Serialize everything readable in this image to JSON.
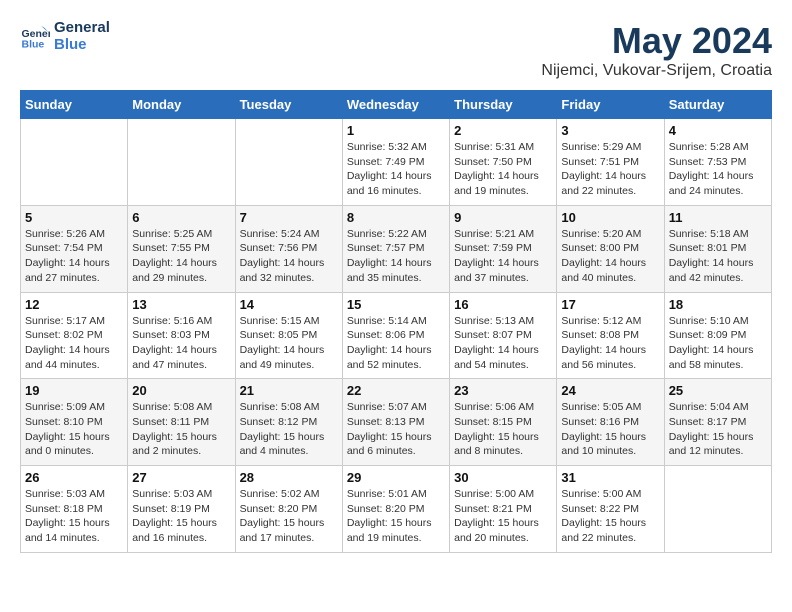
{
  "logo": {
    "line1": "General",
    "line2": "Blue"
  },
  "title": "May 2024",
  "location": "Nijemci, Vukovar-Srijem, Croatia",
  "days_header": [
    "Sunday",
    "Monday",
    "Tuesday",
    "Wednesday",
    "Thursday",
    "Friday",
    "Saturday"
  ],
  "weeks": [
    [
      {
        "day": "",
        "info": ""
      },
      {
        "day": "",
        "info": ""
      },
      {
        "day": "",
        "info": ""
      },
      {
        "day": "1",
        "info": "Sunrise: 5:32 AM\nSunset: 7:49 PM\nDaylight: 14 hours\nand 16 minutes."
      },
      {
        "day": "2",
        "info": "Sunrise: 5:31 AM\nSunset: 7:50 PM\nDaylight: 14 hours\nand 19 minutes."
      },
      {
        "day": "3",
        "info": "Sunrise: 5:29 AM\nSunset: 7:51 PM\nDaylight: 14 hours\nand 22 minutes."
      },
      {
        "day": "4",
        "info": "Sunrise: 5:28 AM\nSunset: 7:53 PM\nDaylight: 14 hours\nand 24 minutes."
      }
    ],
    [
      {
        "day": "5",
        "info": "Sunrise: 5:26 AM\nSunset: 7:54 PM\nDaylight: 14 hours\nand 27 minutes."
      },
      {
        "day": "6",
        "info": "Sunrise: 5:25 AM\nSunset: 7:55 PM\nDaylight: 14 hours\nand 29 minutes."
      },
      {
        "day": "7",
        "info": "Sunrise: 5:24 AM\nSunset: 7:56 PM\nDaylight: 14 hours\nand 32 minutes."
      },
      {
        "day": "8",
        "info": "Sunrise: 5:22 AM\nSunset: 7:57 PM\nDaylight: 14 hours\nand 35 minutes."
      },
      {
        "day": "9",
        "info": "Sunrise: 5:21 AM\nSunset: 7:59 PM\nDaylight: 14 hours\nand 37 minutes."
      },
      {
        "day": "10",
        "info": "Sunrise: 5:20 AM\nSunset: 8:00 PM\nDaylight: 14 hours\nand 40 minutes."
      },
      {
        "day": "11",
        "info": "Sunrise: 5:18 AM\nSunset: 8:01 PM\nDaylight: 14 hours\nand 42 minutes."
      }
    ],
    [
      {
        "day": "12",
        "info": "Sunrise: 5:17 AM\nSunset: 8:02 PM\nDaylight: 14 hours\nand 44 minutes."
      },
      {
        "day": "13",
        "info": "Sunrise: 5:16 AM\nSunset: 8:03 PM\nDaylight: 14 hours\nand 47 minutes."
      },
      {
        "day": "14",
        "info": "Sunrise: 5:15 AM\nSunset: 8:05 PM\nDaylight: 14 hours\nand 49 minutes."
      },
      {
        "day": "15",
        "info": "Sunrise: 5:14 AM\nSunset: 8:06 PM\nDaylight: 14 hours\nand 52 minutes."
      },
      {
        "day": "16",
        "info": "Sunrise: 5:13 AM\nSunset: 8:07 PM\nDaylight: 14 hours\nand 54 minutes."
      },
      {
        "day": "17",
        "info": "Sunrise: 5:12 AM\nSunset: 8:08 PM\nDaylight: 14 hours\nand 56 minutes."
      },
      {
        "day": "18",
        "info": "Sunrise: 5:10 AM\nSunset: 8:09 PM\nDaylight: 14 hours\nand 58 minutes."
      }
    ],
    [
      {
        "day": "19",
        "info": "Sunrise: 5:09 AM\nSunset: 8:10 PM\nDaylight: 15 hours\nand 0 minutes."
      },
      {
        "day": "20",
        "info": "Sunrise: 5:08 AM\nSunset: 8:11 PM\nDaylight: 15 hours\nand 2 minutes."
      },
      {
        "day": "21",
        "info": "Sunrise: 5:08 AM\nSunset: 8:12 PM\nDaylight: 15 hours\nand 4 minutes."
      },
      {
        "day": "22",
        "info": "Sunrise: 5:07 AM\nSunset: 8:13 PM\nDaylight: 15 hours\nand 6 minutes."
      },
      {
        "day": "23",
        "info": "Sunrise: 5:06 AM\nSunset: 8:15 PM\nDaylight: 15 hours\nand 8 minutes."
      },
      {
        "day": "24",
        "info": "Sunrise: 5:05 AM\nSunset: 8:16 PM\nDaylight: 15 hours\nand 10 minutes."
      },
      {
        "day": "25",
        "info": "Sunrise: 5:04 AM\nSunset: 8:17 PM\nDaylight: 15 hours\nand 12 minutes."
      }
    ],
    [
      {
        "day": "26",
        "info": "Sunrise: 5:03 AM\nSunset: 8:18 PM\nDaylight: 15 hours\nand 14 minutes."
      },
      {
        "day": "27",
        "info": "Sunrise: 5:03 AM\nSunset: 8:19 PM\nDaylight: 15 hours\nand 16 minutes."
      },
      {
        "day": "28",
        "info": "Sunrise: 5:02 AM\nSunset: 8:20 PM\nDaylight: 15 hours\nand 17 minutes."
      },
      {
        "day": "29",
        "info": "Sunrise: 5:01 AM\nSunset: 8:20 PM\nDaylight: 15 hours\nand 19 minutes."
      },
      {
        "day": "30",
        "info": "Sunrise: 5:00 AM\nSunset: 8:21 PM\nDaylight: 15 hours\nand 20 minutes."
      },
      {
        "day": "31",
        "info": "Sunrise: 5:00 AM\nSunset: 8:22 PM\nDaylight: 15 hours\nand 22 minutes."
      },
      {
        "day": "",
        "info": ""
      }
    ]
  ]
}
